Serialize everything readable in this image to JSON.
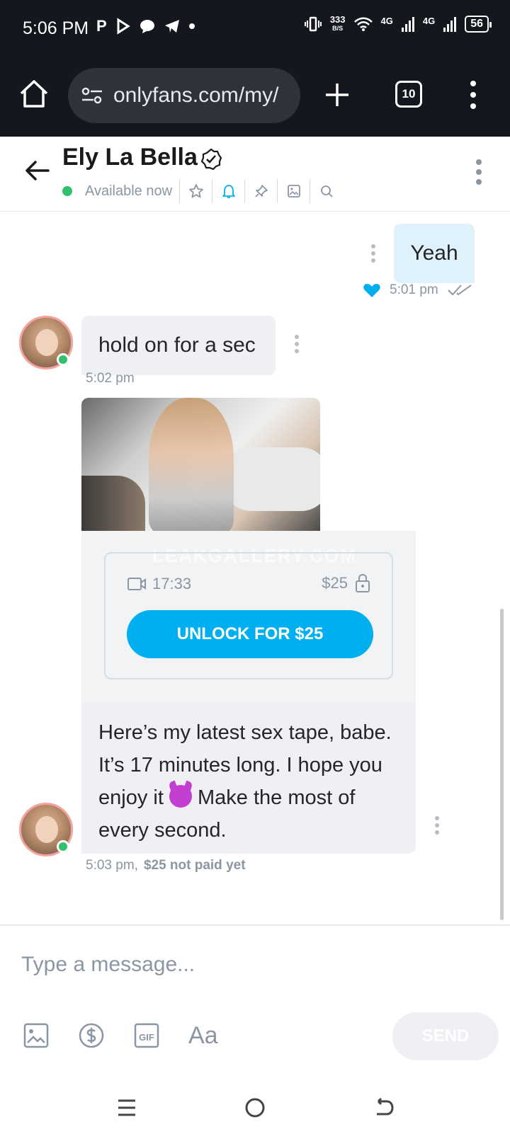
{
  "status_bar": {
    "time": "5:06 PM",
    "notif_letters": [
      "P"
    ],
    "speed_value": "333",
    "speed_unit": "B/S",
    "network_1": "4G",
    "network_2": "4G",
    "battery": "56"
  },
  "browser": {
    "url": "onlyfans.com/my/",
    "tab_count": "10"
  },
  "chat_header": {
    "name": "Ely La Bella",
    "status": "Available now"
  },
  "messages": {
    "outgoing": {
      "text": "Yeah",
      "time": "5:01 pm"
    },
    "incoming_1": {
      "text": "hold on for a sec",
      "time": "5:02 pm"
    },
    "media": {
      "watermark": "LEAKGALLERY.COM",
      "duration": "17:33",
      "price": "$25",
      "unlock_label": "UNLOCK FOR $25"
    },
    "incoming_2": {
      "text_before": "Here’s my latest sex tape, babe. It’s 17 minutes long. I hope you enjoy it ",
      "text_after": " Make the most of every second.",
      "time": "5:03 pm,",
      "payment_status": "$25 not paid yet"
    }
  },
  "composer": {
    "placeholder": "Type a message...",
    "text_format_label": "Aa",
    "send_label": "SEND"
  },
  "colors": {
    "accent": "#00aff0",
    "online": "#2fc26b",
    "muted": "#8a96a3",
    "outgoing_bubble": "#dff1fb",
    "incoming_bubble": "#eff0f3"
  }
}
